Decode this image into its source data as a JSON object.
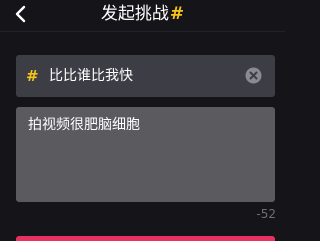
{
  "header": {
    "title": "发起挑战",
    "title_hash": "#",
    "back_icon": "chevron-left-icon"
  },
  "challenge": {
    "hash_symbol": "#",
    "name_value": "比比谁比我快",
    "clear_icon": "clear-circle-icon"
  },
  "description": {
    "value": "拍视频很肥脑细胞"
  },
  "char_counter": "-52",
  "colors": {
    "background": "#151519",
    "accent_yellow": "#f5c518",
    "accent_pink": "#e83160",
    "field_bg": "#3d3d46",
    "textarea_bg": "#5a5a5f"
  }
}
